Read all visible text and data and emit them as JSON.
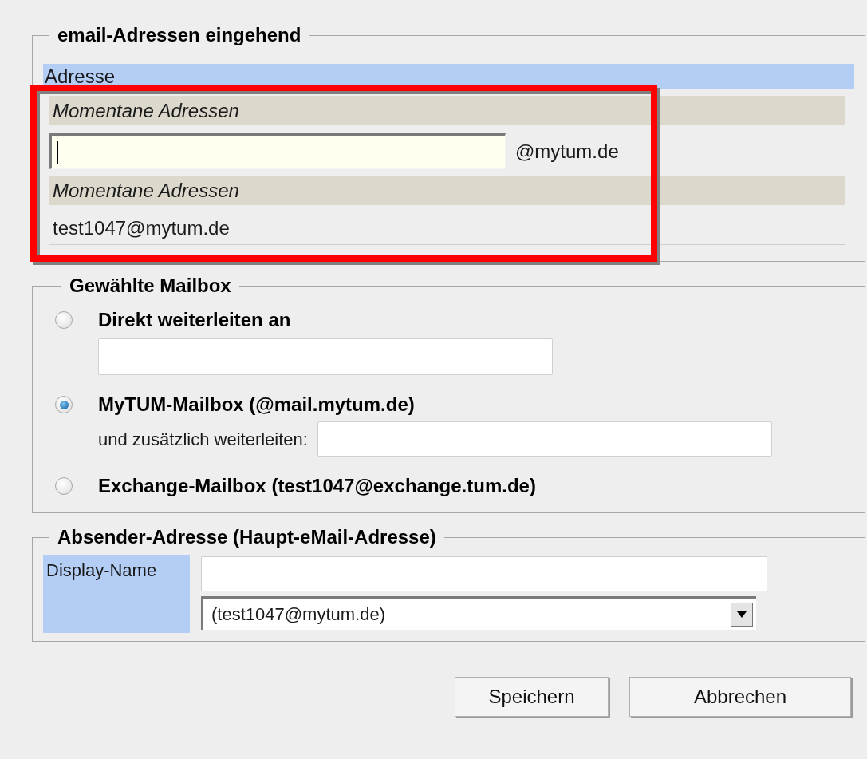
{
  "incoming": {
    "legend": "email-Adressen eingehend",
    "column_header": "Adresse",
    "highlighted": true,
    "rows": [
      {
        "kind": "section",
        "text": "Momentane Adressen"
      },
      {
        "kind": "input",
        "focused": true,
        "suffix": "@mytum.de"
      },
      {
        "kind": "section",
        "text": "Momentane Adressen"
      },
      {
        "kind": "address",
        "text": "test1047@mytum.de"
      }
    ]
  },
  "mailbox": {
    "legend": "Gewählte Mailbox",
    "options": [
      {
        "label": "Direkt weiterleiten an",
        "selected": false,
        "kind": "field"
      },
      {
        "label": "MyTUM-Mailbox (@mail.mytum.de)",
        "selected": true,
        "kind": "labeled_field",
        "field_label": "und zusätzlich weiterleiten:"
      },
      {
        "label": "Exchange-Mailbox (test1047@exchange.tum.de)",
        "selected": false,
        "kind": "plain"
      }
    ]
  },
  "sender": {
    "legend": "Absender-Adresse (Haupt-eMail-Adresse)",
    "label": "Display-Name",
    "select_value": "(test1047@mytum.de)"
  },
  "buttons": [
    "Speichern",
    "Abbrechen"
  ]
}
